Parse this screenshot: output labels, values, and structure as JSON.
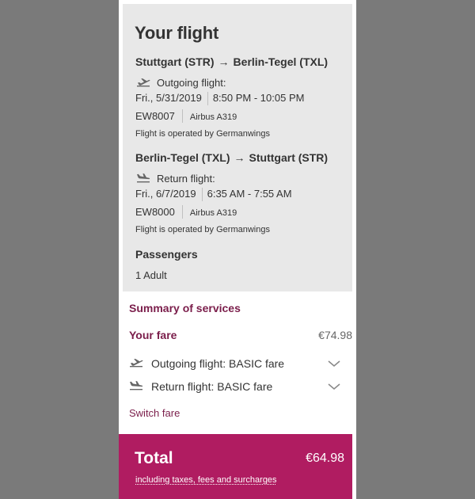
{
  "flight": {
    "title": "Your flight",
    "outbound": {
      "from": "Stuttgart (STR)",
      "to": "Berlin-Tegel (TXL)",
      "label": "Outgoing flight:",
      "date": "Fri., 5/31/2019",
      "time": "8:50 PM - 10:05 PM",
      "flight_no": "EW8007",
      "aircraft": "Airbus A319",
      "operated": "Flight is operated by Germanwings",
      "icon": "plane-takeoff-icon"
    },
    "return": {
      "from": "Berlin-Tegel (TXL)",
      "to": "Stuttgart (STR)",
      "label": "Return flight:",
      "date": "Fri., 6/7/2019",
      "time": "6:35 AM - 7:55 AM",
      "flight_no": "EW8000",
      "aircraft": "Airbus A319",
      "operated": "Flight is operated by Germanwings",
      "icon": "plane-landing-icon"
    },
    "passengers_title": "Passengers",
    "passengers_value": "1 Adult"
  },
  "summary": {
    "title": "Summary of services",
    "fare_label": "Your fare",
    "fare_price": "€74.98",
    "services": [
      {
        "label": "Outgoing flight: BASIC fare",
        "icon": "plane-takeoff-icon"
      },
      {
        "label": "Return flight: BASIC fare",
        "icon": "plane-landing-icon"
      }
    ],
    "switch_fare": "Switch fare"
  },
  "total": {
    "label": "Total",
    "price": "€64.98",
    "note": "including taxes, fees and surcharges"
  },
  "colors": {
    "accent": "#b01c61",
    "heading_magenta": "#7a1d4a",
    "box_gray": "#e8e8e8",
    "backdrop": "#7a7a7a"
  }
}
